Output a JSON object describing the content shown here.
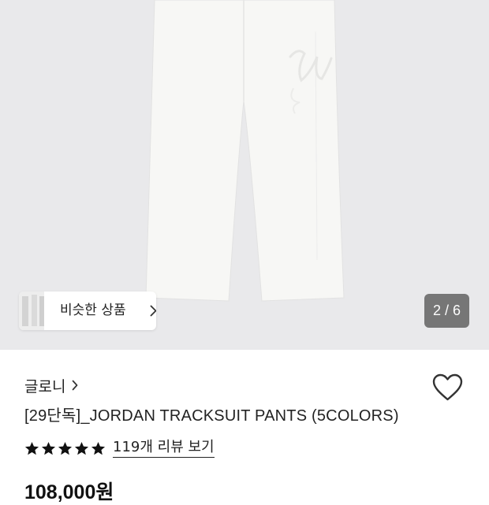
{
  "gallery": {
    "similar_products_label": "비슷한 상품",
    "image_counter": "2 / 6"
  },
  "product": {
    "brand": "글로니",
    "title": "[29단독]_JORDAN TRACKSUIT PANTS (5COLORS)",
    "rating_stars": 5,
    "review_link": "119개 리뷰 보기",
    "price": "108,000원"
  },
  "colors": {
    "hero_bg": "#e9e9eb",
    "pants": "#f7f7f5",
    "star": "#111111"
  },
  "icons": [
    "chevron-right-icon",
    "heart-icon",
    "star-icon"
  ]
}
